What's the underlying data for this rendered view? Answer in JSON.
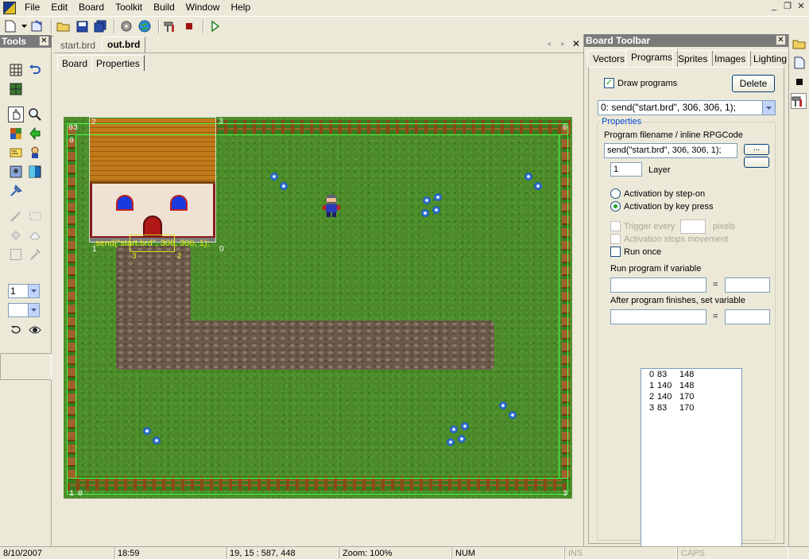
{
  "menu": [
    "File",
    "Edit",
    "Board",
    "Toolkit",
    "Build",
    "Window",
    "Help"
  ],
  "window_controls": {
    "minimize": "_",
    "restore": "❐",
    "close": "✕"
  },
  "tools_panel": {
    "title": "Tools",
    "close": "✕",
    "layer_select": "1",
    "second_select": ""
  },
  "doc_tabs": [
    "start.brd",
    "out.brd"
  ],
  "doc_nav": {
    "prev": "◂",
    "next": "▸",
    "close": "✕"
  },
  "board_subtabs": [
    "Board",
    "Properties"
  ],
  "board": {
    "vector_labels": {
      "v0_tl": "0",
      "v2_tl": "2",
      "v3_tl": "3",
      "v3_tr": "3",
      "v0_tr": "0",
      "v0_left": "0",
      "v1_bl": "1",
      "v0_bl": "0",
      "v3_br": "3"
    },
    "program_label": "send(\"start.brd\", 306, 306, 1);",
    "program_vertex_labels": {
      "p1": "1",
      "p0": "0",
      "p3": "3",
      "p2": "2"
    }
  },
  "board_toolbar": {
    "title": "Board Toolbar",
    "close": "✕",
    "tabs": [
      "Vectors",
      "Programs",
      "Sprites",
      "Images",
      "Lighting"
    ],
    "active_tab": "Programs",
    "draw_programs_label": "Draw programs",
    "draw_programs_checked": "✓",
    "delete_label": "Delete",
    "program_select": "0: send(\"start.brd\", 306, 306, 1);",
    "properties_legend": "Properties",
    "program_filename_label": "Program filename / inline RPGCode",
    "program_filename_value": "send(\"start.brd\", 306, 306, 1);",
    "browse_label": "...",
    "layer_value": "1",
    "layer_label": "Layer",
    "activation_step_on": "Activation by step-on",
    "activation_key_press": "Activation by key press",
    "trigger_every_label": "Trigger every",
    "pixels_label": "pixels",
    "activation_stops_label": "Activation stops movement",
    "run_once_label": "Run once",
    "run_if_label": "Run program if variable",
    "after_label": "After program finishes, set variable",
    "equals": "=",
    "points": [
      [
        "0",
        "83",
        "148"
      ],
      [
        "1",
        "140",
        "148"
      ],
      [
        "2",
        "140",
        "170"
      ],
      [
        "3",
        "83",
        "170"
      ]
    ]
  },
  "status": {
    "date": "8/10/2007",
    "time": "18:59",
    "coords": "19, 15 : 587, 448",
    "zoom": "Zoom:  100%",
    "num": "NUM",
    "ins": "INS",
    "caps": "CAPS"
  },
  "colors": {
    "accent_green": "#21a121",
    "vector_green": "#48ff48",
    "program_yellow": "#e0e020",
    "panel_title": "#7a7a7a"
  }
}
